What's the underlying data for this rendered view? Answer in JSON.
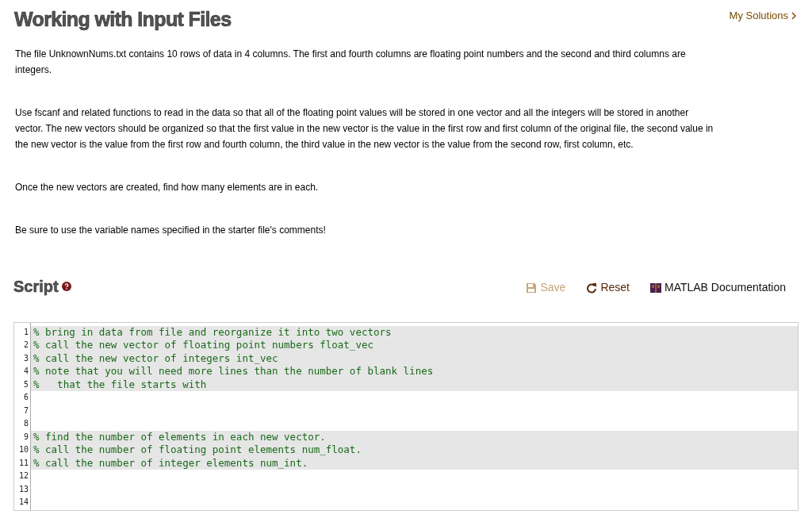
{
  "title": "Working with Input Files",
  "my_solutions_link": "My Solutions",
  "paragraphs": [
    "The file UnknownNums.txt contains 10 rows of data in 4 columns.  The first and fourth columns are floating point numbers and the second and third columns are integers.",
    "Use fscanf and related functions to read in the data so that all of the floating point values will be stored in one vector and all the integers will be stored in another vector.  The new vectors should be organized so that the first value in the new vector is the value in the first row and first column of the original file, the second value in the new vector is the value from the first row and fourth column, the third value in the new vector is the value from the second row, first column, etc.",
    "Once the new vectors are created, find how many elements are in each.",
    "Be sure to use the variable names specified in the starter file's comments!"
  ],
  "script": {
    "heading": "Script",
    "toolbar": [
      {
        "label": "Save",
        "disabled": true,
        "kind": "save"
      },
      {
        "label": "Reset",
        "disabled": false,
        "kind": "reset"
      },
      {
        "label": "MATLAB Documentation",
        "disabled": false,
        "kind": "docs"
      }
    ],
    "lines": [
      {
        "number": "1",
        "text": "% bring in data from file and reorganize it into two vectors",
        "locked": true
      },
      {
        "number": "2",
        "text": "% call the new vector of floating point numbers float_vec",
        "locked": true
      },
      {
        "number": "3",
        "text": "% call the new vector of integers int_vec",
        "locked": true
      },
      {
        "number": "4",
        "text": "% note that you will need more lines than the number of blank lines",
        "locked": true
      },
      {
        "number": "5",
        "text": "%   that the file starts with",
        "locked": true
      },
      {
        "number": "6",
        "locked": false
      },
      {
        "number": "7",
        "locked": false
      },
      {
        "number": "8",
        "locked": false
      },
      {
        "number": "9",
        "text": "% find the number of elements in each new vector.",
        "locked": true
      },
      {
        "number": "10",
        "text": "% call the number of floating point elements num_float.",
        "locked": true
      },
      {
        "number": "11",
        "text": "% call the number of integer elements num_int.",
        "locked": true
      },
      {
        "number": "12",
        "locked": false
      },
      {
        "number": "13",
        "locked": false
      },
      {
        "number": "14",
        "locked": false
      }
    ]
  }
}
